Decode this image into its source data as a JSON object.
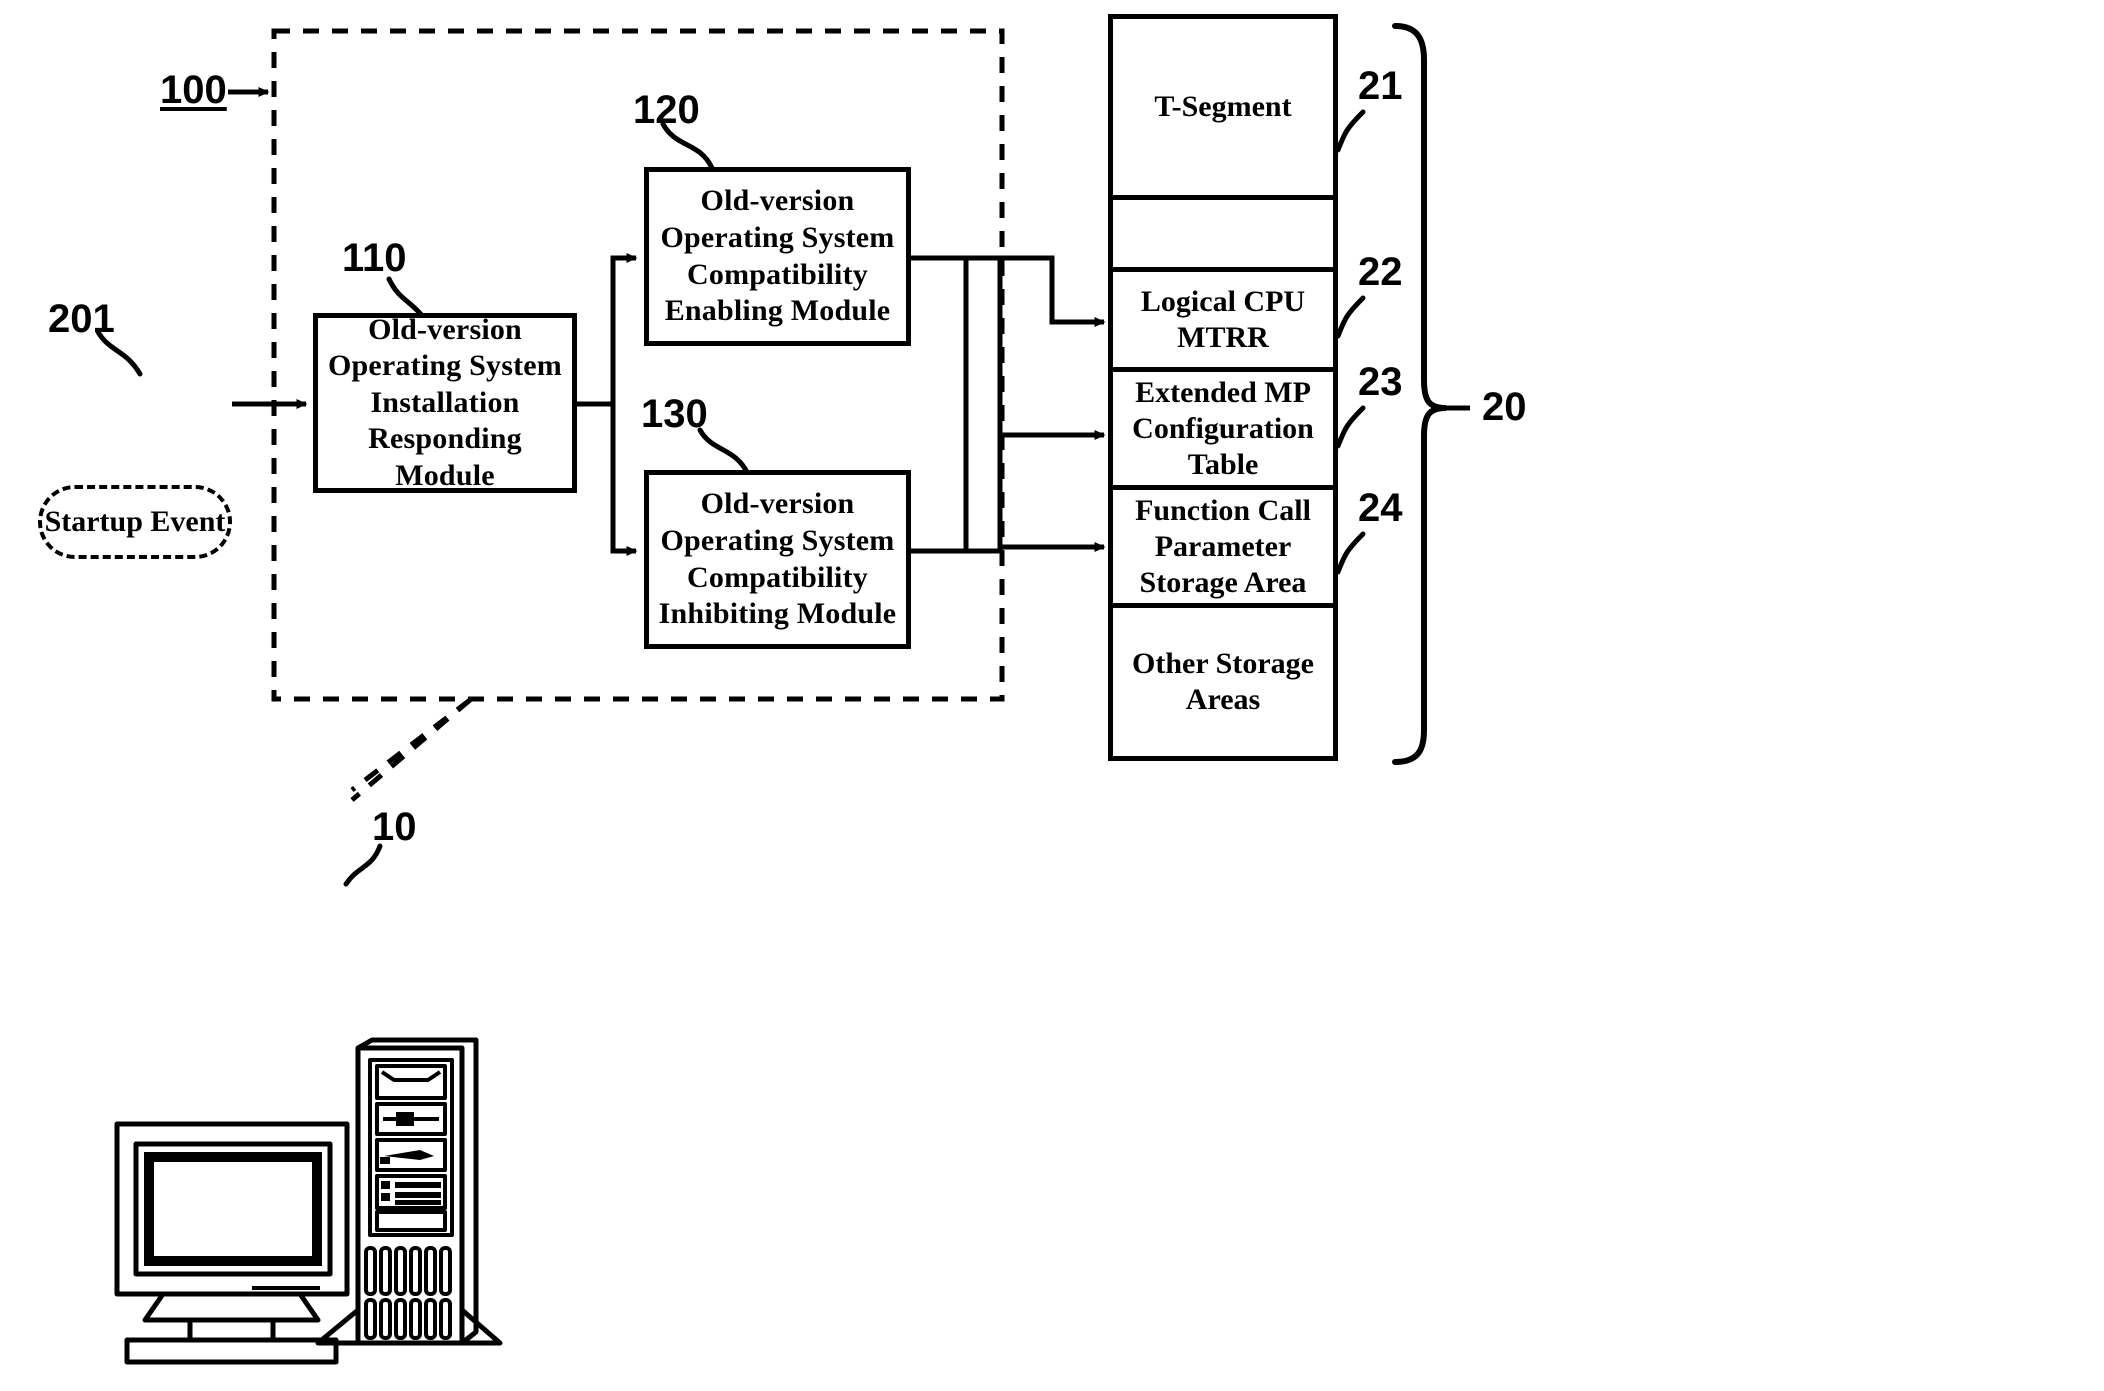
{
  "figure": {
    "type": "patent-block-diagram",
    "refs": {
      "system_100": "100",
      "module_110": "110",
      "module_120": "120",
      "module_130": "130",
      "event_201": "201",
      "computer_10": "10",
      "memory_20": "20",
      "segment_21": "21",
      "segment_22": "22",
      "segment_23": "23",
      "segment_24": "24"
    }
  },
  "startup_event": {
    "label": "Startup Event"
  },
  "modules": [
    {
      "ref": "110",
      "lines": [
        "Old-version",
        "Operating System",
        "Installation",
        "Responding Module"
      ]
    },
    {
      "ref": "120",
      "lines": [
        "Old-version",
        "Operating System",
        "Compatibility",
        "Enabling Module"
      ]
    },
    {
      "ref": "130",
      "lines": [
        "Old-version",
        "Operating System",
        "Compatibility",
        "Inhibiting Module"
      ]
    }
  ],
  "memory": {
    "ref": "20",
    "cells": [
      {
        "ref": "21",
        "lines": [
          "T-Segment"
        ]
      },
      {
        "ref": "",
        "lines": []
      },
      {
        "ref": "22",
        "lines": [
          "Logical CPU",
          "MTRR"
        ]
      },
      {
        "ref": "23",
        "lines": [
          "Extended MP",
          "Configuration",
          "Table"
        ]
      },
      {
        "ref": "24",
        "lines": [
          "Function Call",
          "Parameter",
          "Storage Area"
        ]
      },
      {
        "ref": "",
        "lines": [
          "Other Storage",
          "Areas"
        ]
      }
    ]
  },
  "computer": {
    "ref": "10",
    "icon": "desktop-computer-icon"
  },
  "colors": {
    "ink": "#000000",
    "paper": "#ffffff"
  }
}
